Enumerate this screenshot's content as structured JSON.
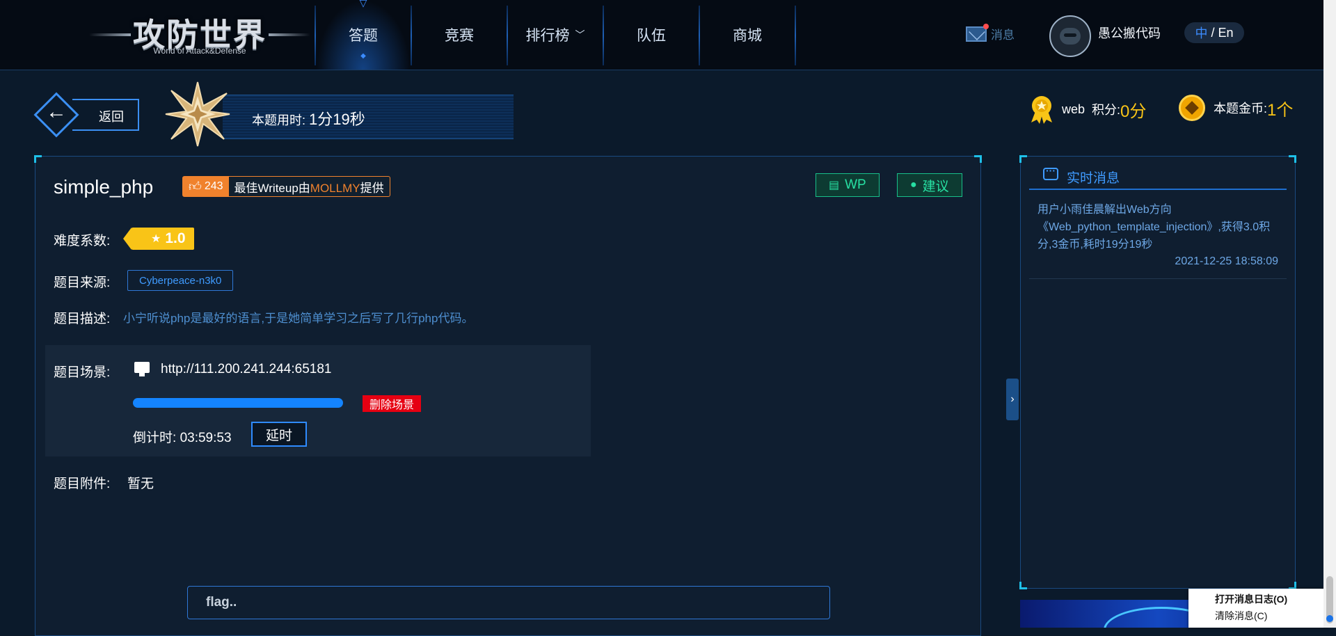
{
  "header": {
    "logo": {
      "title": "攻防世界",
      "subtitle": "World of Attack&Defense"
    },
    "nav": [
      {
        "label": "答题",
        "active": true
      },
      {
        "label": "竞赛"
      },
      {
        "label": "排行榜",
        "icon": "chevron-down-icon"
      },
      {
        "label": "队伍"
      },
      {
        "label": "商城"
      }
    ],
    "messages_label": "消息",
    "user_name": "愚公搬代码",
    "lang": {
      "zh": "中",
      "sep": " / ",
      "en": "En"
    }
  },
  "infobar": {
    "back_label": "返回",
    "time_label": "本题用时: ",
    "time_value": "1分19秒",
    "category": "web",
    "score_label": "积分: ",
    "score_value": "0分",
    "coin_label": "本题金币: ",
    "coin_value": "1个"
  },
  "task": {
    "title": "simple_php",
    "likes": "243",
    "writeup_prefix": "最佳Writeup由",
    "writeup_author": "MOLLMY",
    "writeup_suffix": "提供",
    "wp_label": "WP",
    "suggest_label": "建议",
    "difficulty_label": "难度系数:",
    "difficulty_value": "1.0",
    "source_label": "题目来源:",
    "source_value": "Cyberpeace-n3k0",
    "desc_label": "题目描述:",
    "desc_value": "小宁听说php是最好的语言,于是她简单学习之后写了几行php代码。",
    "scene_label": "题目场景:",
    "scene_url": "http://111.200.241.244:65181",
    "scene_progress": 1.0,
    "delete_label": "删除场景",
    "countdown_label": "倒计时: ",
    "countdown_value": "03:59:53",
    "delay_label": "延时",
    "attach_label": "题目附件:",
    "attach_value": "暂无",
    "flag_placeholder": "flag.."
  },
  "realtime": {
    "title": "实时消息",
    "message": "用户小雨佳晨解出Web方向《Web_python_template_injection》,获得3.0积分,3金币,耗时19分19秒",
    "time": "2021-12-25 18:58:09"
  },
  "context_menu": {
    "open_log": "打开消息日志(O)",
    "clear": "清除消息(C)"
  },
  "colors": {
    "accent": "#3f9bff",
    "gold": "#f9c417",
    "orange": "#f0822d",
    "green": "#27e0a3",
    "danger": "#e60012"
  }
}
